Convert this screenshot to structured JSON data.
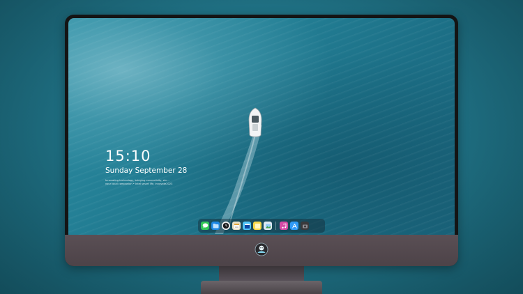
{
  "lock_screen": {
    "time": "15:10",
    "date": "Sunday September 28",
    "fine_print_line1": "Innovating technology, bringing connectivity, etc...",
    "fine_print_line2": "your local companion • Intel smart life, innovate2023"
  },
  "dock": {
    "items": [
      {
        "name": "messages",
        "icon": "message-bubble-icon",
        "color": "#34c759"
      },
      {
        "name": "finder",
        "icon": "finder-folder-icon",
        "color": "#1e88e5"
      },
      {
        "name": "clock",
        "icon": "clock-icon",
        "color": "#f5f5f5"
      },
      {
        "name": "notes",
        "icon": "notes-icon",
        "color": "#e0a43a"
      },
      {
        "name": "clapper",
        "icon": "clapper-icon",
        "color": "#4fc3f7"
      },
      {
        "name": "stickies",
        "icon": "sticky-note-icon",
        "color": "#f7d84a"
      },
      {
        "name": "preview",
        "icon": "photo-preview-icon",
        "color": "#90caf9"
      },
      {
        "name": "music",
        "icon": "music-note-icon",
        "color": "#d54aa6"
      },
      {
        "name": "app-store",
        "icon": "app-store-icon",
        "color": "#2f9bf5"
      },
      {
        "name": "camera",
        "icon": "camera-icon",
        "color": "#3a3a3c"
      }
    ]
  },
  "colors": {
    "background": "#1f6f82",
    "monitor_bezel": "#141414",
    "monitor_chin": "#544a4f",
    "stand": "#5a5358"
  }
}
